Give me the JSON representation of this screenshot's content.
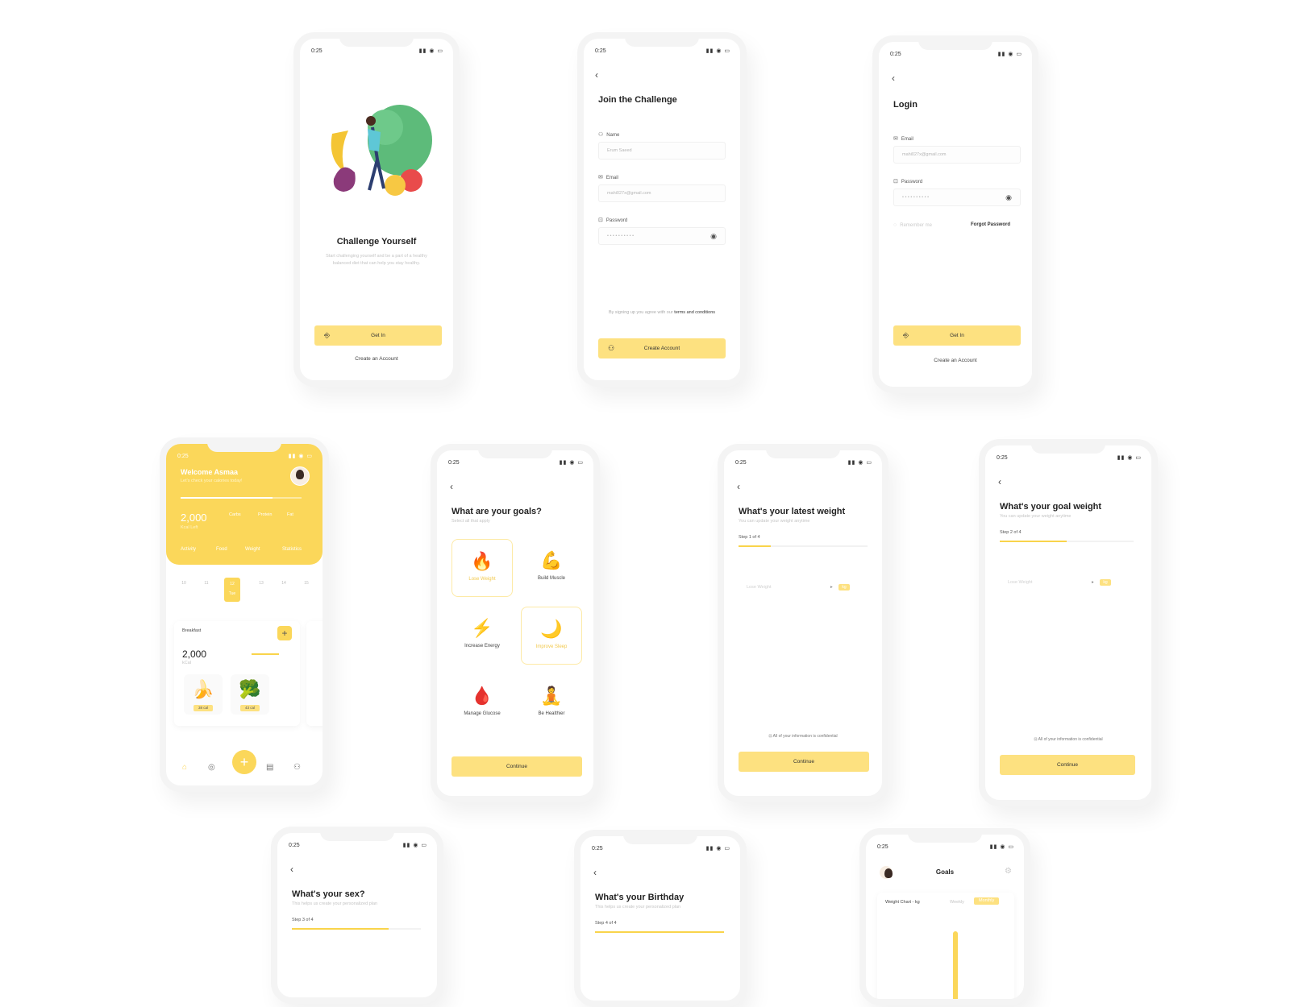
{
  "status": {
    "time": "0:25",
    "icons": "▮▮ ◉ ▭"
  },
  "screens": {
    "onboarding": {
      "title": "Challenge Yourself",
      "subtitle": "Start challenging yourself and be a part of a healthy balanced diet that can help you stay healthy.",
      "get_in": "Get In",
      "create_account": "Create an Account"
    },
    "signup": {
      "title": "Join the Challenge",
      "name_label": "Name",
      "name_value": "Erum Saeed",
      "email_label": "Email",
      "email_value": "mahi027x@gmail.com",
      "password_label": "Password",
      "password_value": "• • • • • • • • • •",
      "terms_text": "By signing up you agree with our",
      "terms_link": "terms and conditions",
      "create_button": "Create Account"
    },
    "login": {
      "title": "Login",
      "email_label": "Email",
      "email_value": "mahi027x@gmail.com",
      "password_label": "Password",
      "password_value": "• • • • • • • • • •",
      "remember": "Remember me",
      "forgot": "Forgot Password",
      "get_in": "Get In",
      "create_account": "Create an Account"
    },
    "dashboard": {
      "welcome": "Welcome Asmaa",
      "subtitle": "Let's check your calories today!",
      "kcal_value": "2,000",
      "kcal_label": "Kcal Left",
      "stats": [
        "Carbs",
        "Protein",
        "Fat"
      ],
      "tabs": [
        "Activity",
        "Food",
        "Weight",
        "Statistics"
      ],
      "days": [
        "10",
        "11",
        "12",
        "13",
        "14",
        "15"
      ],
      "active_day": "12",
      "active_day_label": "Tue",
      "meal_title": "Breakfast",
      "meal_kcal": "2,000",
      "meal_unit": "kCal",
      "food1_cal": "38 cal",
      "food2_cal": "43 cal",
      "fab": "+",
      "accent": "#fbd75a"
    },
    "goals": {
      "title": "What are your goals?",
      "subtitle": "Select all that apply",
      "items": [
        {
          "label": "Lose Weight",
          "icon": "flame-icon",
          "glyph": "🔥"
        },
        {
          "label": "Build Muscle",
          "icon": "muscle-icon",
          "glyph": "💪"
        },
        {
          "label": "Increase Energy",
          "icon": "lightning-icon",
          "glyph": "⚡"
        },
        {
          "label": "Improve Sleep",
          "icon": "moon-icon",
          "glyph": "🌙"
        },
        {
          "label": "Manage Glucose",
          "icon": "drops-icon",
          "glyph": "🩸"
        },
        {
          "label": "Be Healthier",
          "icon": "meditation-icon",
          "glyph": "🧘"
        }
      ],
      "continue": "Continue"
    },
    "latest_weight": {
      "title": "What's your latest weight",
      "subtitle": "You can update your weight anytime",
      "step": "Step 1 of 4",
      "progress": 0.25,
      "input_placeholder": "Lose Weight",
      "unit": "kg",
      "confidential": "All of your information is confidential",
      "continue": "Continue"
    },
    "goal_weight": {
      "title": "What's your goal weight",
      "subtitle": "You can update your weight anytime",
      "step": "Step 2 of 4",
      "progress": 0.5,
      "input_placeholder": "Lose Weight",
      "unit": "kg",
      "confidential": "All of your information is confidential",
      "continue": "Continue"
    },
    "sex": {
      "title": "What's your sex?",
      "subtitle": "This helps us create your personalized plan",
      "step": "Step 3 of 4",
      "progress": 0.75
    },
    "birthday": {
      "title": "What's your Birthday",
      "subtitle": "This helps us create your personalized plan",
      "step": "Step 4 of 4",
      "progress": 1.0
    },
    "goals_chart": {
      "title": "Goals",
      "chart_label": "Weight Chart - kg",
      "chip_inactive": "Weekly",
      "chip_active": "Monthly"
    }
  }
}
